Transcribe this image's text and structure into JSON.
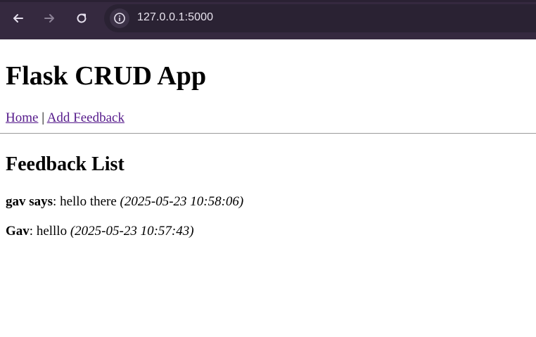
{
  "browser": {
    "url": "127.0.0.1:5000"
  },
  "page": {
    "title": "Flask CRUD App",
    "nav": {
      "home_label": "Home",
      "separator": "|",
      "add_label": "Add Feedback"
    },
    "section_title": "Feedback List",
    "entries": [
      {
        "name": "gav says",
        "message": "hello there",
        "timestamp": "(2025-05-23 10:58:06)"
      },
      {
        "name": "Gav",
        "message": "helllo",
        "timestamp": "(2025-05-23 10:57:43)"
      }
    ]
  },
  "colors": {
    "browser_bar": "#35293f",
    "link_visited": "#551a8b"
  },
  "icons": [
    "back-arrow-icon",
    "forward-arrow-icon",
    "reload-icon",
    "info-icon"
  ]
}
